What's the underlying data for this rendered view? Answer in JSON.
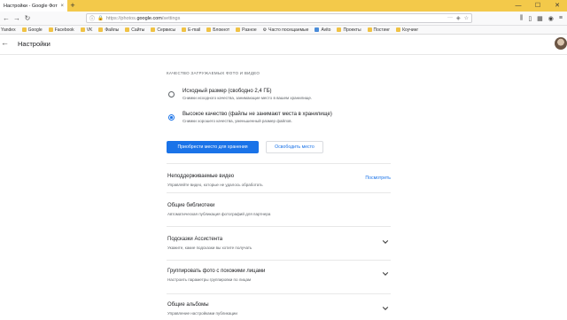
{
  "browser": {
    "tab_title": "Настройки - Google Фото",
    "tab_close": "×",
    "new_tab": "+",
    "window_controls": [
      "—",
      "☐",
      "✕"
    ],
    "url_prefix": "https://photos.",
    "url_domain": "google.com",
    "url_path": "/settings",
    "bookmarks": [
      "Yandex",
      "Google",
      "Facebook",
      "VK",
      "Файлы",
      "Сайты",
      "Сервисы",
      "E-mail",
      "Блокнот",
      "Разное",
      "Часто посещаемые",
      "Avito",
      "Проекты",
      "Постинг",
      "Коучинг"
    ]
  },
  "header": {
    "back": "←",
    "title": "Настройки"
  },
  "upload": {
    "section_label": "КАЧЕСТВО ЗАГРУЖАЕМЫХ ФОТО И ВИДЕО",
    "options": [
      {
        "title": "Исходный размер (свободно 2,4 ГБ)",
        "subtitle": "Снимки исходного качества, занимающие место в вашем хранилище.",
        "checked": false
      },
      {
        "title": "Высокое качество (файлы не занимают места в хранилище)",
        "subtitle": "Снимки хорошего качества, уменьшенный размер файлов.",
        "checked": true
      }
    ],
    "buy_button": "Приобрести место для хранения",
    "free_button": "Освободить место"
  },
  "rows": [
    {
      "title": "Неподдерживаемые видео",
      "subtitle": "Управляйте видео, которые не удалось обработать",
      "link": "Посмотреть"
    },
    {
      "title": "Общие библиотеки",
      "subtitle": "Автоматическая публикация фотографий для партнера"
    },
    {
      "title": "Подсказки Ассистента",
      "subtitle": "Укажите, какие подсказки вы хотите получать",
      "expandable": true
    },
    {
      "title": "Группировать фото с похожими лицами",
      "subtitle": "Настроить параметры группировки по лицам",
      "expandable": true
    },
    {
      "title": "Общие альбомы",
      "subtitle": "Управление настройками публикации",
      "expandable": true
    }
  ],
  "colors": {
    "accent": "#1a73e8",
    "tabbar": "#f3c94a"
  }
}
